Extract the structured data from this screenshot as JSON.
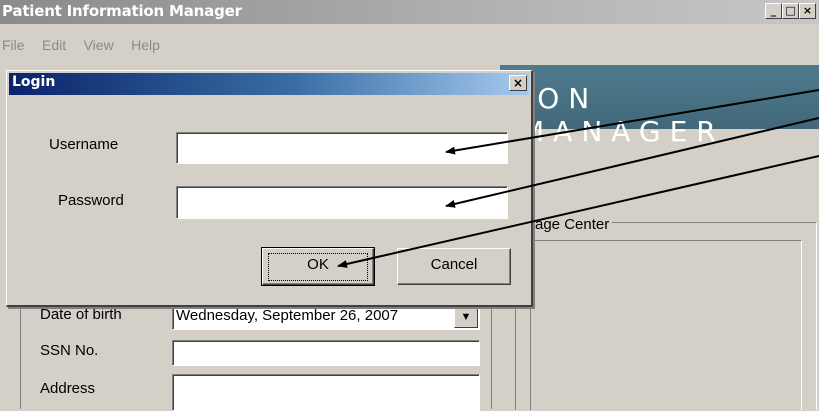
{
  "window": {
    "title": "Patient Information Manager",
    "controls": {
      "minimize": "_",
      "maximize": "□",
      "close": "×"
    }
  },
  "menu": [
    "File",
    "Edit",
    "View",
    "Help"
  ],
  "banner": {
    "text": "ION MANAGER"
  },
  "message_center": {
    "label": "ssage Center"
  },
  "patient_form": {
    "dob_label": "Date of birth",
    "dob_value": "Wednesday, September 26, 2007",
    "ssn_label": "SSN No.",
    "ssn_value": "",
    "address_label": "Address",
    "address_value": ""
  },
  "login": {
    "title": "Login",
    "close": "×",
    "username_label": "Username",
    "username_value": "",
    "password_label": "Password",
    "password_value": "",
    "ok_label": "OK",
    "cancel_label": "Cancel"
  },
  "icons": {
    "dropdown": "chevron-down-icon",
    "arrows": "annotation-arrow-icon"
  },
  "colors": {
    "titlebar_active": "#0a246a",
    "banner": "#4f7a8e",
    "face": "#d4d0c8"
  }
}
